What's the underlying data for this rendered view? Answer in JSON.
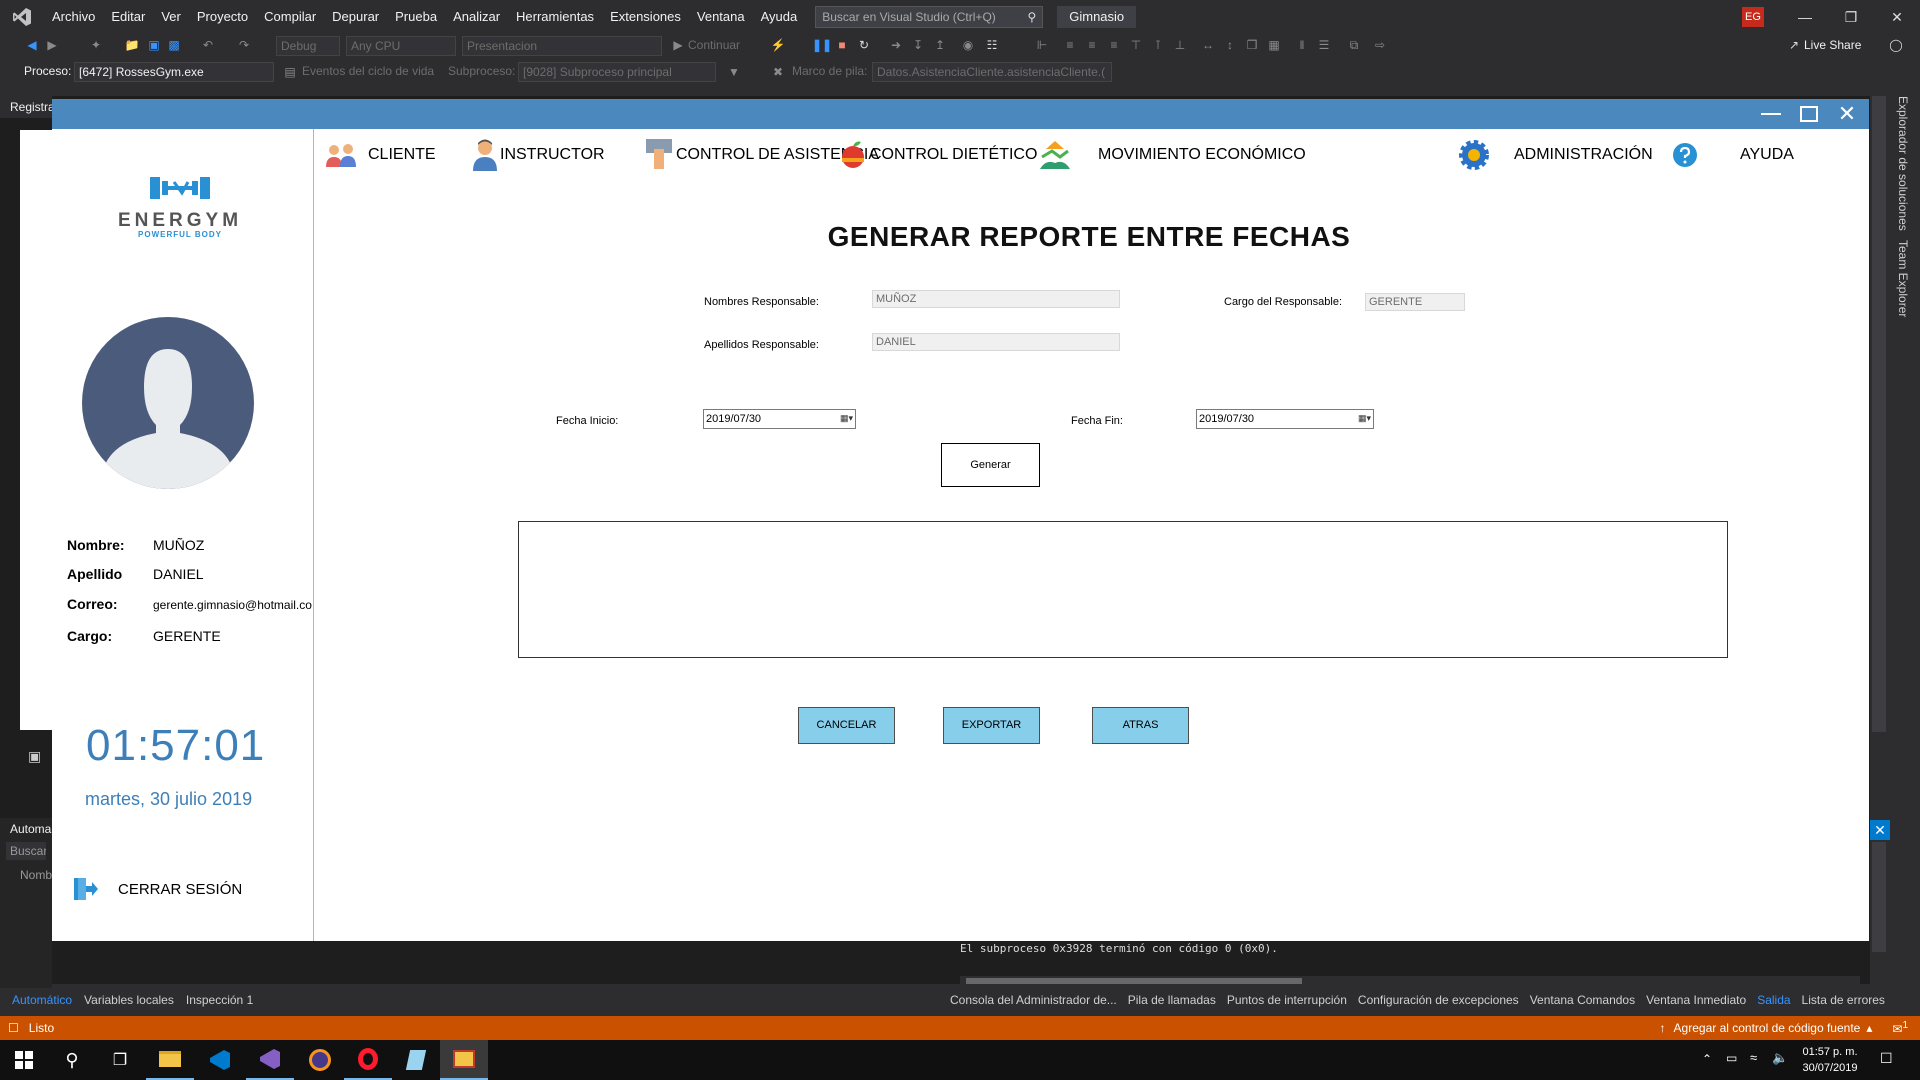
{
  "vs": {
    "menu": [
      "Archivo",
      "Editar",
      "Ver",
      "Proyecto",
      "Compilar",
      "Depurar",
      "Prueba",
      "Analizar",
      "Herramientas",
      "Extensiones",
      "Ventana",
      "Ayuda"
    ],
    "search_placeholder": "Buscar en Visual Studio (Ctrl+Q)",
    "solution_name": "Gimnasio",
    "user_initials": "EG",
    "live_share": "Live Share",
    "toolbar": {
      "config": "Debug",
      "platform": "Any CPU",
      "startup": "Presentacion",
      "continue": "Continuar"
    },
    "toolbar2": {
      "process_label": "Proceso:",
      "process_value": "[6472] RossesGym.exe",
      "lifecycle_label": "Eventos del ciclo de vida",
      "thread_label": "Subproceso:",
      "thread_value": "[9028] Subproceso principal",
      "stack_label": "Marco de pila:",
      "stack_value": "Datos.AsistenciaCliente.asistenciaCliente.("
    },
    "right_tabs": [
      "Explorador de soluciones",
      "Team Explorer"
    ],
    "left_panel": {
      "tab_stub": "Registra",
      "autos_stub": "Automa",
      "search_stub": "Buscar",
      "name_stub": "Nomb"
    },
    "output_line": "El subproceso 0x3928 terminó con código 0 (0x0).",
    "bottom_tabs_left": [
      "Automático",
      "Variables locales",
      "Inspección 1"
    ],
    "bottom_tabs_right": [
      "Consola del Administrador de...",
      "Pila de llamadas",
      "Puntos de interrupción",
      "Configuración de excepciones",
      "Ventana Comandos",
      "Ventana Inmediato",
      "Salida",
      "Lista de errores"
    ],
    "status": {
      "ready": "Listo",
      "source_control": "Agregar al control de código fuente",
      "notifications": "1"
    }
  },
  "taskbar": {
    "time": "01:57 p. m.",
    "date": "30/07/2019"
  },
  "app": {
    "sidebar": {
      "logo_text": "ENERGYM",
      "logo_tagline": "POWERFUL BODY",
      "fields": [
        {
          "key": "Nombre:",
          "value": "MUÑOZ"
        },
        {
          "key": "Apellido",
          "value": "DANIEL"
        },
        {
          "key": "Correo:",
          "value": "gerente.gimnasio@hotmail.co"
        },
        {
          "key": "Cargo:",
          "value": "GERENTE"
        }
      ],
      "clock": "01:57:01",
      "date": "martes, 30 julio 2019",
      "logout": "CERRAR SESIÓN"
    },
    "nav": [
      "CLIENTE",
      "INSTRUCTOR",
      "CONTROL DE ASISTENCIA",
      "CONTROL DIETÉTICO",
      "MOVIMIENTO ECONÓMICO",
      "ADMINISTRACIÓN",
      "AYUDA"
    ],
    "title": "GENERAR REPORTE ENTRE FECHAS",
    "form": {
      "nombres_label": "Nombres Responsable:",
      "nombres_value": "MUÑOZ",
      "apellidos_label": "Apellidos Responsable:",
      "apellidos_value": "DANIEL",
      "cargo_label": "Cargo del Responsable:",
      "cargo_value": "GERENTE",
      "fecha_inicio_label": "Fecha Inicio:",
      "fecha_inicio_value": "2019/07/30",
      "fecha_fin_label": "Fecha Fin:",
      "fecha_fin_value": "2019/07/30",
      "generar": "Generar"
    },
    "buttons": {
      "cancelar": "CANCELAR",
      "exportar": "EXPORTAR",
      "atras": "ATRAS"
    }
  },
  "colors": {
    "vs_bg": "#2d2d30",
    "status_orange": "#ca5100",
    "app_title_blue": "#4a88be",
    "clock_blue": "#3d7fb8",
    "button_skyblue": "#87ceeb"
  }
}
